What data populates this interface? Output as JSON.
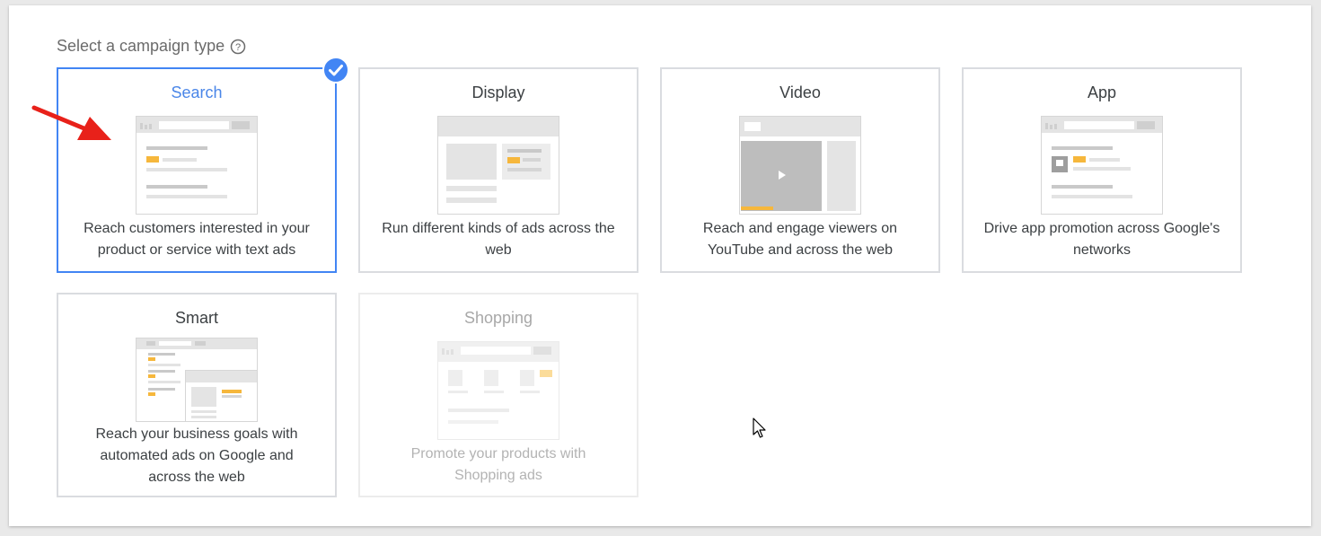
{
  "section": {
    "label": "Select a campaign type",
    "help_icon": "help-circle-icon"
  },
  "cards": [
    {
      "id": "search",
      "title": "Search",
      "description_lines": [
        "Reach customers interested in your",
        "product or service with text ads"
      ],
      "selected": true,
      "disabled": false
    },
    {
      "id": "display",
      "title": "Display",
      "description_lines": [
        "Run different kinds of ads across the",
        "web"
      ],
      "selected": false,
      "disabled": false
    },
    {
      "id": "video",
      "title": "Video",
      "description_lines": [
        "Reach and engage viewers on",
        "YouTube and across the web"
      ],
      "selected": false,
      "disabled": false
    },
    {
      "id": "app",
      "title": "App",
      "description_lines": [
        "Drive app promotion across Google's",
        "networks"
      ],
      "selected": false,
      "disabled": false
    },
    {
      "id": "smart",
      "title": "Smart",
      "description_lines": [
        "Reach your business goals with",
        "automated ads on Google and",
        "across the web"
      ],
      "selected": false,
      "disabled": false
    },
    {
      "id": "shopping",
      "title": "Shopping",
      "description_lines": [
        "Promote your products with",
        "Shopping ads"
      ],
      "selected": false,
      "disabled": true
    }
  ],
  "colors": {
    "accent": "#4285f4",
    "highlight": "#f6b73c",
    "border": "#dadce0",
    "annotation_arrow": "#e8211a"
  },
  "icons": {
    "selected_badge": "check-circle-icon",
    "annotation": "red-arrow-icon",
    "cursor": "mouse-pointer-icon"
  }
}
